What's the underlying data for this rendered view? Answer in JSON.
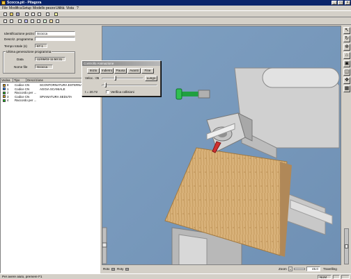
{
  "window": {
    "title": "Scocca.pit - Pitagora"
  },
  "menu": [
    "File",
    "Modifica",
    "Setup",
    "Modello pezzo",
    "Utilità",
    "Vista",
    "?"
  ],
  "form": {
    "id_label": "Identificazione pezzo",
    "id_value": "Scocca",
    "desc_label": "Descriz. programma",
    "desc_value": "",
    "time_label": "Tempo totale (s)",
    "time_value": "67.1",
    "gen_group": "Ultima generazione programma",
    "date_label": "Data",
    "date_value": "11/05/03 11:50:31",
    "file_label": "Nome file",
    "file_value": "Scocca"
  },
  "list": {
    "headers": [
      "Vedea",
      "Tipo",
      "Descrizione"
    ],
    "rows": [
      {
        "num": "8",
        "color": "#e0a000",
        "type": "Codice CN",
        "desc": "SCONTORNATURA ESTERNA"
      },
      {
        "num": "1",
        "color": "#2080ff",
        "type": "Codice CN",
        "desc": "AGGIA SCANIALE"
      },
      {
        "num": "2",
        "color": "#20c020",
        "type": "Raccordo per ...",
        "desc": ""
      },
      {
        "num": "3",
        "color": "#e0a000",
        "type": "Codice CN",
        "desc": "SPIANATURA SEDUTA"
      },
      {
        "num": "4",
        "color": "#20c020",
        "type": "Raccordo per ...",
        "desc": ""
      }
    ]
  },
  "dialog": {
    "title": "Controllo Animazione",
    "buttons": [
      "Inizio",
      "Indietro",
      "Pausa",
      "Avanti",
      "Fine"
    ],
    "speed_label": "Veloc.: 05",
    "lungo_label": "Lungo",
    "time_label": "t = 20.72",
    "collision_label": "Verifica collisioni",
    "speed_fraction": 0.32,
    "time_fraction": 0.05
  },
  "bottom": {
    "rotx": "Rotx",
    "roty": "Roty",
    "zoom_label": "Zoom",
    "zoom_value": "45.0",
    "travelling_label": "Travelling"
  },
  "status": {
    "text": "Per avere aiuto, premere F1",
    "num": "NUM"
  },
  "colors": {
    "titlebar": "#0a246a",
    "sky": "#7fa0c0",
    "machine": "#d8d8d8",
    "wood": "#d6b07a"
  },
  "right_tools": [
    "cursor-icon",
    "rotate-icon",
    "zoom-icon",
    "house-icon",
    "view-front-icon",
    "view-top-icon",
    "move-icon",
    "grid-icon"
  ]
}
